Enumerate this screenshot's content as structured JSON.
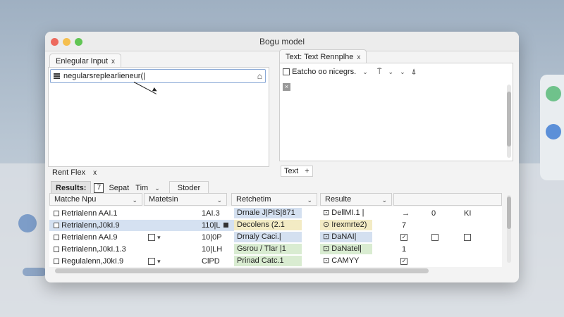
{
  "window": {
    "title": "Bogu model"
  },
  "left_tab": {
    "label": "Enlegular Input",
    "close": "x"
  },
  "regex_input": {
    "value": "negularsreplearlieneur(|"
  },
  "right_tab": {
    "label": "Text: Text Rennplhe",
    "close": "x"
  },
  "replace_row": {
    "label": "Eatcho oo nicegrs."
  },
  "bottom_left_tab": {
    "label": "Rent Flex",
    "close": "x"
  },
  "bottom_right_tab": {
    "label": "Text",
    "extra": "+"
  },
  "results": {
    "label": "Results:",
    "count": "7",
    "options": [
      "Sepat",
      "Tim"
    ],
    "builder": "Stoder"
  },
  "columns": [
    "Matche Npu",
    "Matetsin",
    "Retchetim",
    "Resulte"
  ],
  "rows": [
    {
      "match": "Retrialenn AAI.1",
      "position": "1AI.3",
      "replacement": "Drnale J|PIS|871",
      "result": "DellMI.1 |",
      "arrow": "→",
      "n1": "0",
      "n2": "KI"
    },
    {
      "match": "Retrialenn,J0kI.9",
      "position": "110|L",
      "replacement": "Decolens (2.1",
      "result": "Irexmrte2)",
      "n1": "7"
    },
    {
      "match": "Retrialenn AAI.9",
      "position": "10|0P",
      "replacement": "Drnaly Caci.|",
      "result": "DaNAI|"
    },
    {
      "match": "Retrialenn,J0kI.1.3",
      "position": "10|LH",
      "replacement": "Gsrou / Tlar |1",
      "result": "DaNatel|",
      "n1": "1"
    },
    {
      "match": "Regulalenn,J0kI.9",
      "position": "ClPD",
      "replacement": "Prinad Catc.1",
      "result": "CAMYY"
    }
  ],
  "colors": {
    "blue_row": "#d5e1f1",
    "yellow_tag": "#f3ebc4",
    "green_tag": "#d9ecd1",
    "blue_tag": "#d4e0f0"
  }
}
